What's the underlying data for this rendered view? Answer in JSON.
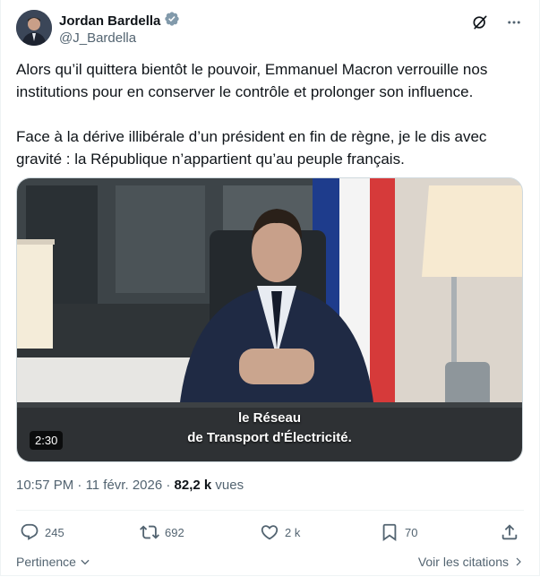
{
  "author": {
    "display_name": "Jordan Bardella",
    "handle": "@J_Bardella"
  },
  "tweet": {
    "paragraphs": [
      "Alors qu’il quittera bientôt le pouvoir, Emmanuel Macron verrouille nos institutions pour en conserver le contrôle et prolonger son influence.",
      "Face à la dérive illibérale d’un président en fin de règne, je le dis avec gravité : la République n’appartient qu’au peuple français."
    ]
  },
  "video": {
    "caption_line1": "le Réseau",
    "caption_line2": "de Transport d'Électricité.",
    "duration": "2:30"
  },
  "meta": {
    "time": "10:57 PM",
    "separator": "·",
    "date": "11 févr. 2026",
    "views_count": "82,2 k",
    "views_label": "vues"
  },
  "actions": {
    "replies": "245",
    "reposts": "692",
    "likes": "2 k",
    "bookmarks": "70"
  },
  "footer": {
    "sort_label": "Pertinence",
    "quotes_label": "Voir les citations"
  },
  "colors": {
    "text": "#0f1419",
    "secondary": "#536471",
    "verified": "#829aab",
    "border": "#eff3f4"
  }
}
